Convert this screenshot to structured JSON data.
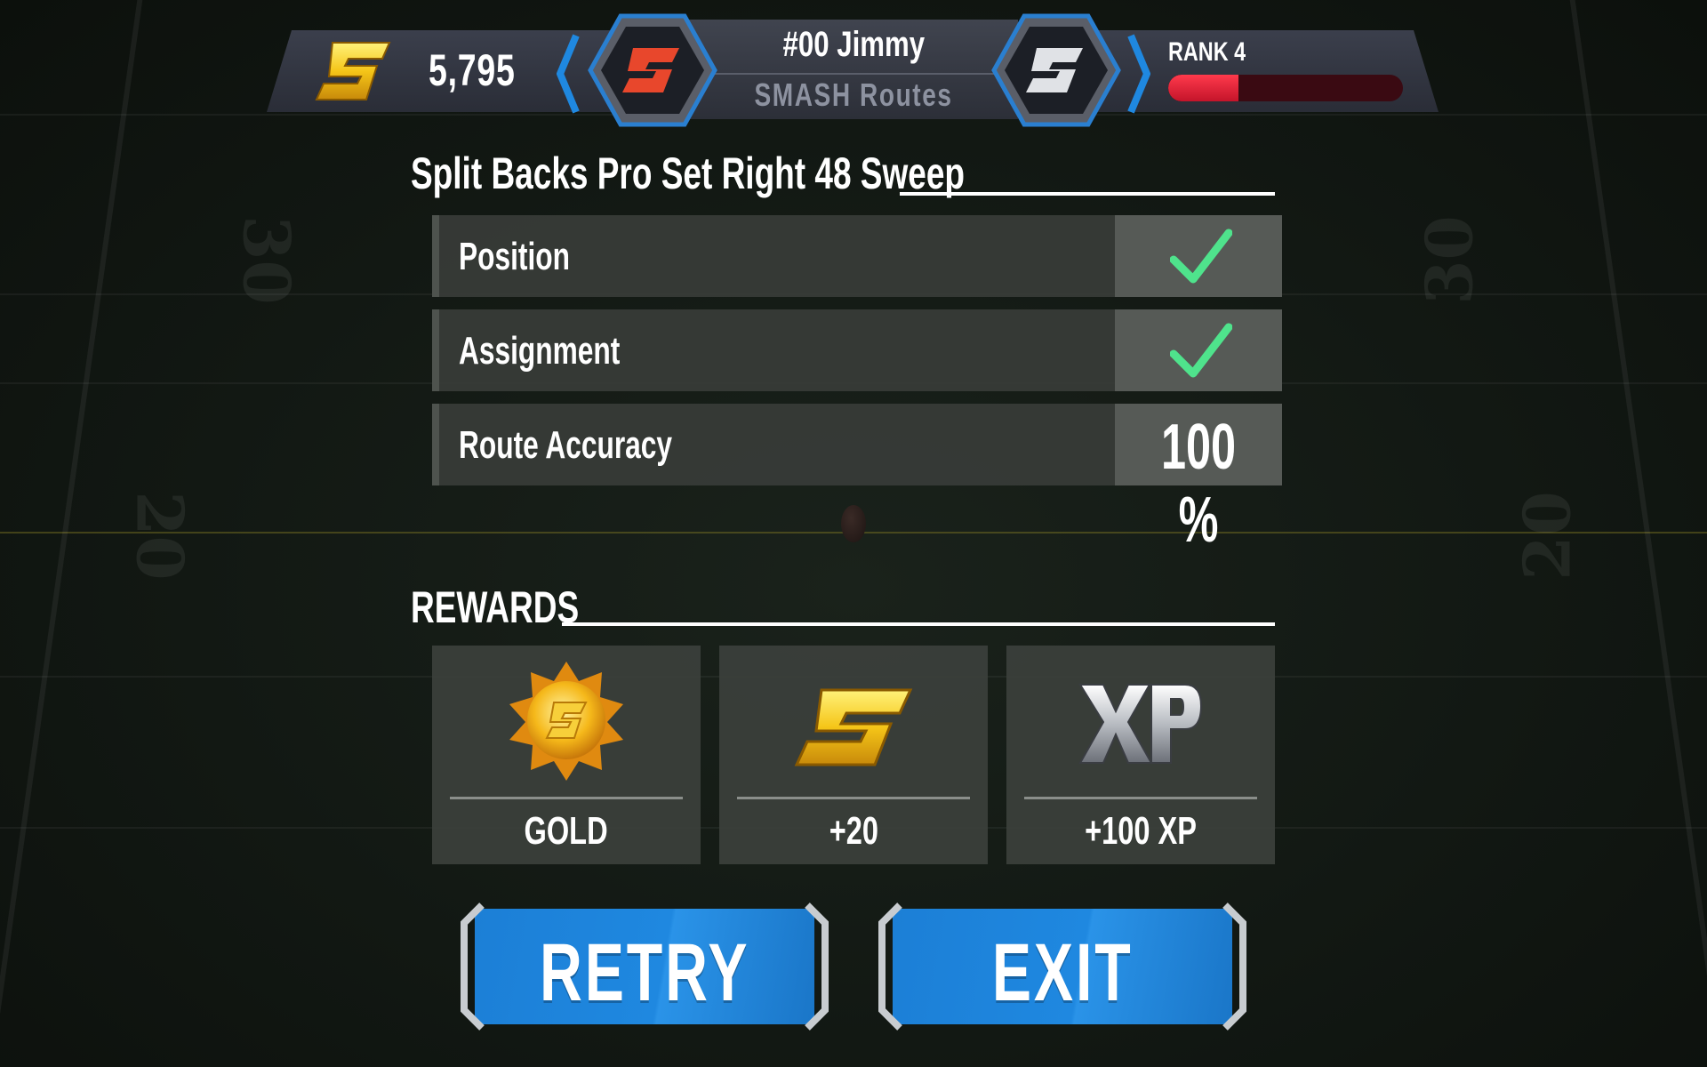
{
  "header": {
    "currency_amount": "5,795",
    "player_name": "#00 Jimmy",
    "mode_name": "SMASH Routes",
    "rank_label": "RANK 4",
    "rank_progress": 0.3
  },
  "play": {
    "title": "Split Backs Pro Set Right 48 Sweep",
    "rows": [
      {
        "label": "Position",
        "status": "check"
      },
      {
        "label": "Assignment",
        "status": "check"
      },
      {
        "label": "Route Accuracy",
        "value": "100 %"
      }
    ]
  },
  "rewards": {
    "title": "REWARDS",
    "items": [
      {
        "label": "GOLD",
        "icon": "gold-medal-icon"
      },
      {
        "label": "+20",
        "icon": "smash-coin-icon"
      },
      {
        "label": "+100 XP",
        "icon": "xp-icon"
      }
    ]
  },
  "buttons": {
    "retry_label": "RETRY",
    "exit_label": "EXIT"
  },
  "colors": {
    "accent_blue": "#1f88e0",
    "check_green": "#4fe38c",
    "rank_red": "#e8233a",
    "coin_gold": "#f5c518"
  }
}
